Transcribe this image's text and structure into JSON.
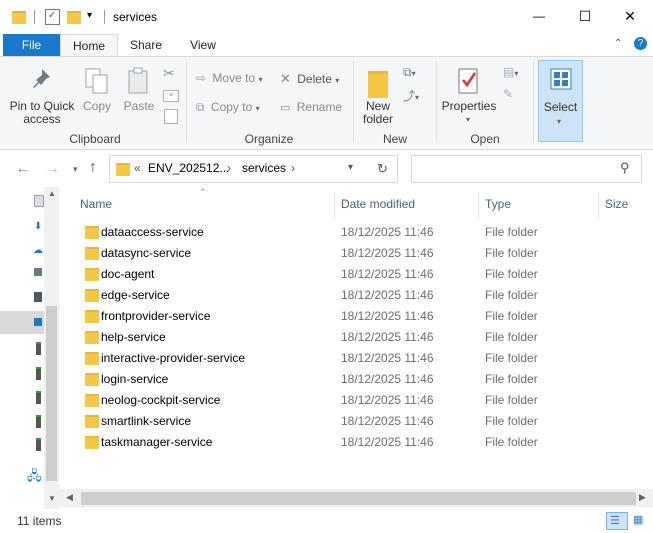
{
  "window": {
    "title": "services",
    "minimize_glyph": "—",
    "maximize_glyph": "☐",
    "close_glyph": "✕"
  },
  "ribbon_tabs": {
    "file": "File",
    "home": "Home",
    "share": "Share",
    "view": "View"
  },
  "clipboard": {
    "pin_label_1": "Pin to Quick",
    "pin_label_2": "access",
    "copy": "Copy",
    "paste": "Paste",
    "group": "Clipboard"
  },
  "organize": {
    "move_to": "Move to",
    "copy_to": "Copy to",
    "delete": "Delete",
    "rename": "Rename",
    "group": "Organize"
  },
  "new": {
    "new_folder_1": "New",
    "new_folder_2": "folder",
    "group": "New"
  },
  "open": {
    "properties": "Properties",
    "group": "Open"
  },
  "select": {
    "label": "Select"
  },
  "address": {
    "chevrons": "«",
    "segment_1": "ENV_202512...",
    "segment_2": "services",
    "search_placeholder": ""
  },
  "columns": {
    "name": "Name",
    "date_modified": "Date modified",
    "type": "Type",
    "size": "Size"
  },
  "files": [
    {
      "name": "dataaccess-service",
      "date": "18/12/2025 11:46",
      "type": "File folder"
    },
    {
      "name": "datasync-service",
      "date": "18/12/2025 11:46",
      "type": "File folder"
    },
    {
      "name": "doc-agent",
      "date": "18/12/2025 11:46",
      "type": "File folder"
    },
    {
      "name": "edge-service",
      "date": "18/12/2025 11:46",
      "type": "File folder"
    },
    {
      "name": "frontprovider-service",
      "date": "18/12/2025 11:46",
      "type": "File folder"
    },
    {
      "name": "help-service",
      "date": "18/12/2025 11:46",
      "type": "File folder"
    },
    {
      "name": "interactive-provider-service",
      "date": "18/12/2025 11:46",
      "type": "File folder"
    },
    {
      "name": "login-service",
      "date": "18/12/2025 11:46",
      "type": "File folder"
    },
    {
      "name": "neolog-cockpit-service",
      "date": "18/12/2025 11:46",
      "type": "File folder"
    },
    {
      "name": "smartlink-service",
      "date": "18/12/2025 11:46",
      "type": "File folder"
    },
    {
      "name": "taskmanager-service",
      "date": "18/12/2025 11:46",
      "type": "File folder"
    }
  ],
  "status": {
    "item_count": "11 items"
  },
  "colors": {
    "file_tab": "#1979ca",
    "folder": "#f6c746",
    "header_text": "#4c607a"
  }
}
